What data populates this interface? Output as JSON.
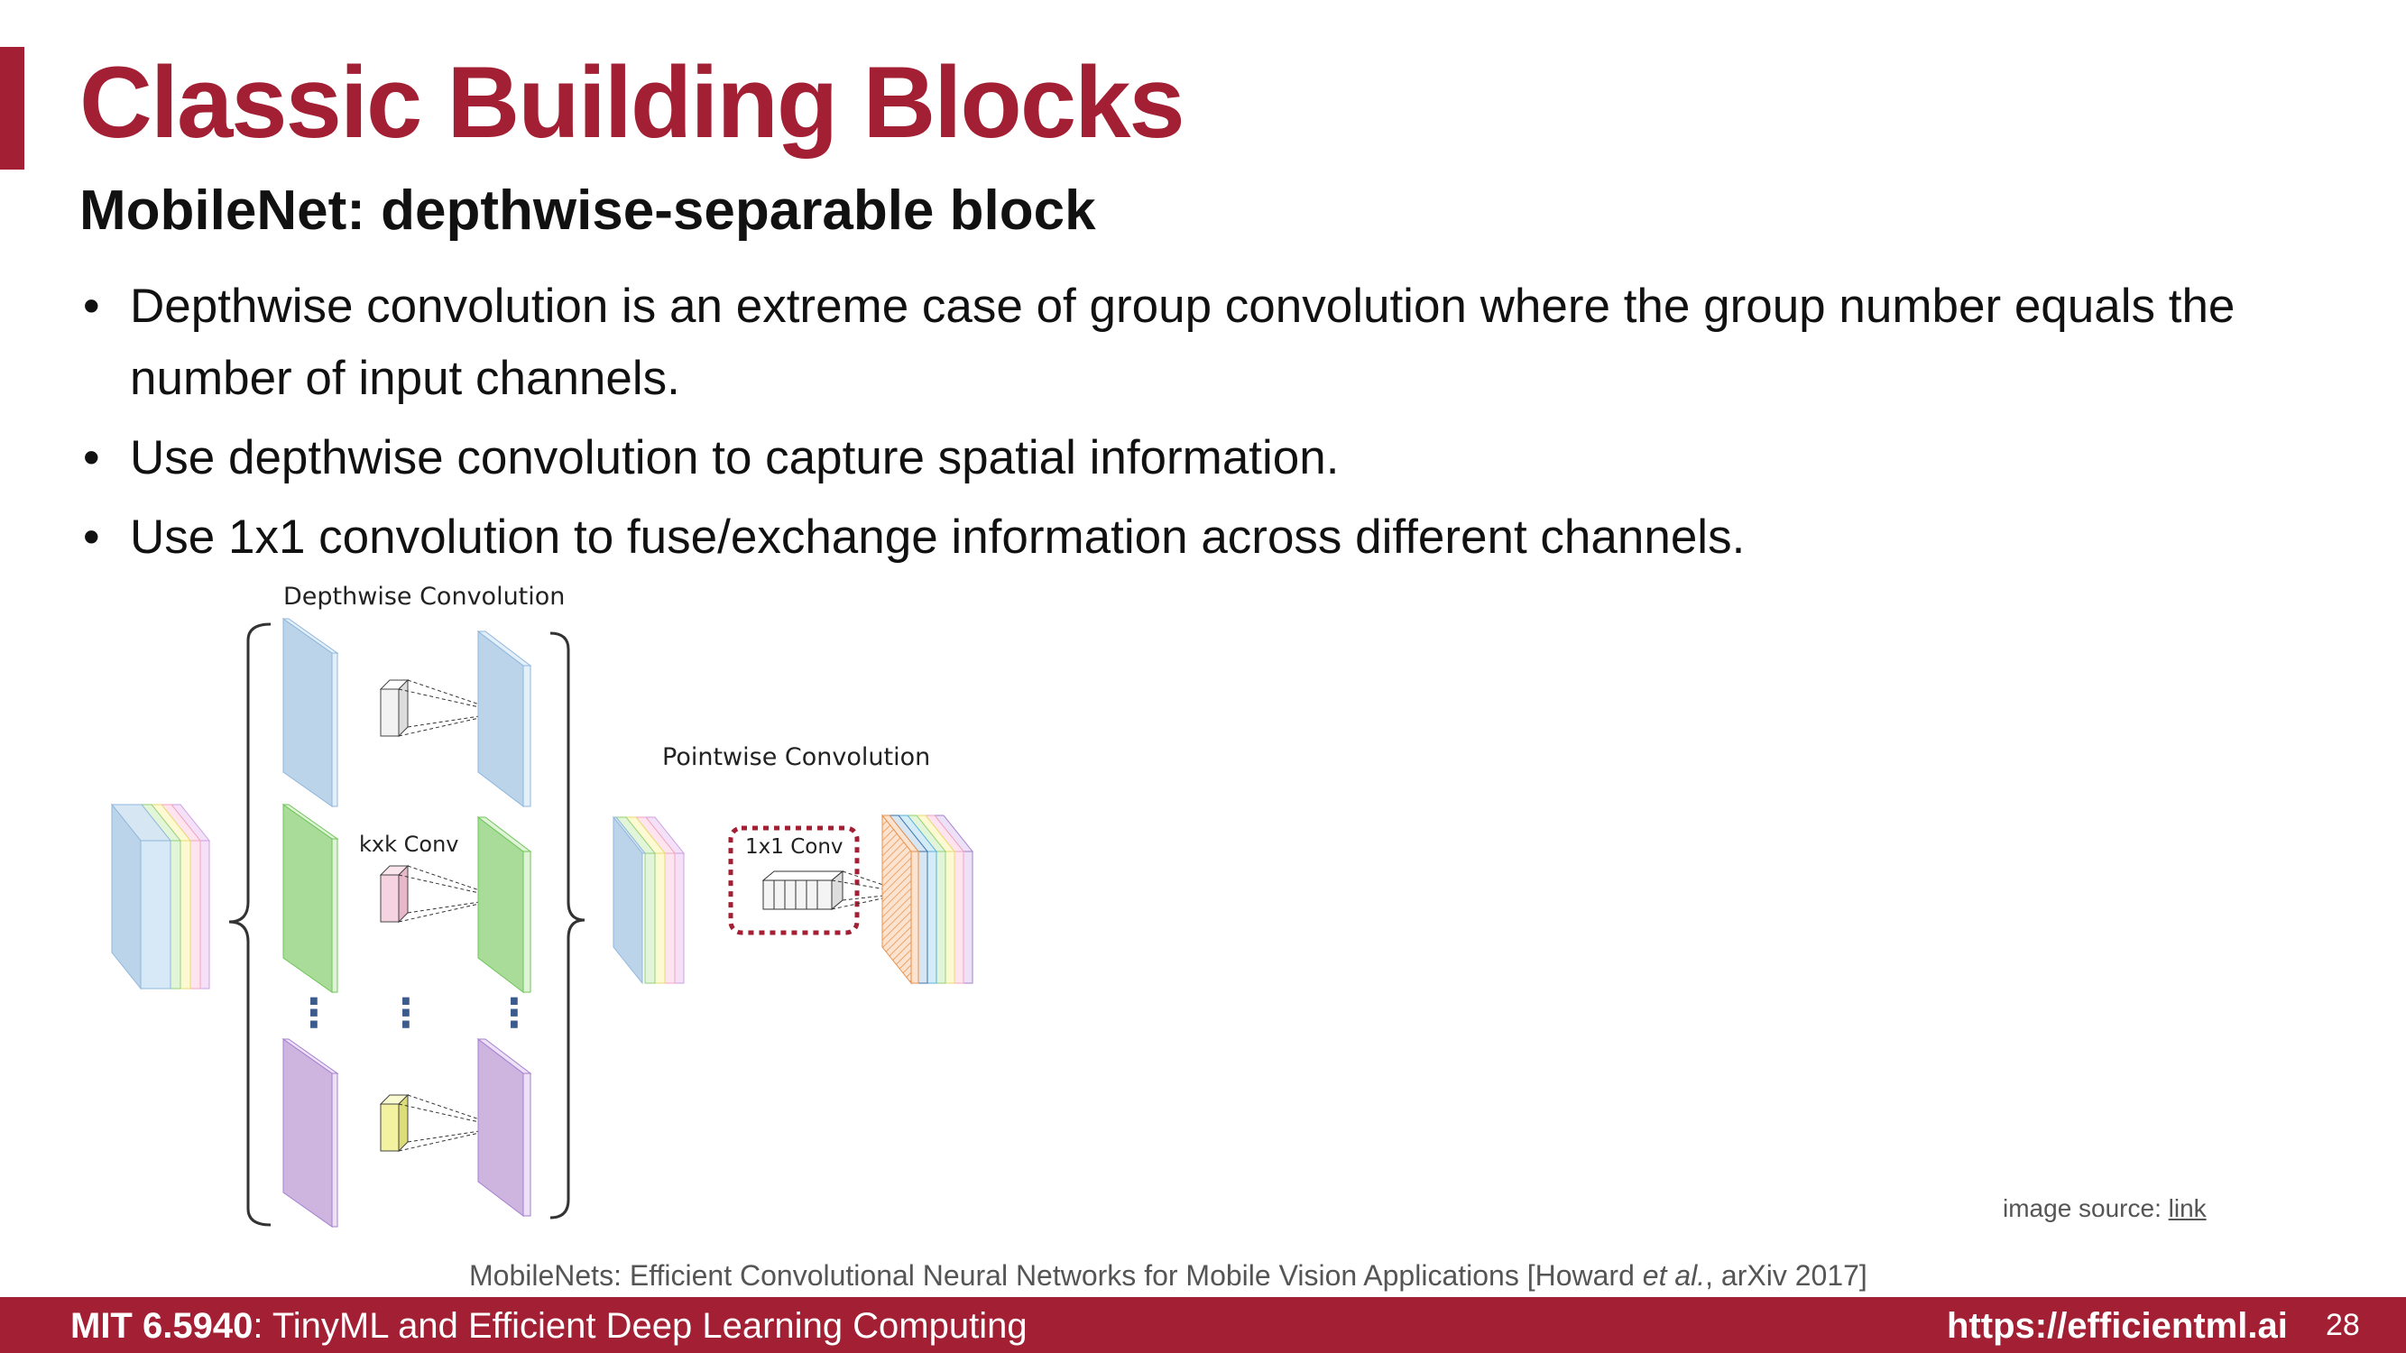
{
  "slide": {
    "title": "Classic Building Blocks",
    "subtitle": "MobileNet: depthwise-separable block",
    "bullets": [
      "Depthwise convolution is an extreme case of group convolution where the group number equals the number of input channels.",
      "Use depthwise convolution to capture spatial information.",
      "Use 1x1 convolution to fuse/exchange information across different channels."
    ],
    "bullet_marker": "•"
  },
  "diagram": {
    "depthwise_label": "Depthwise Convolution",
    "kxk_label": "kxk Conv",
    "pointwise_label": "Pointwise Convolution",
    "conv1x1_label": "1x1 Conv",
    "ellipsis": "⋮",
    "colors": {
      "blue": "#bcd4ea",
      "green": "#a8dc98",
      "purple": "#cdb5e0",
      "orange": "#e8904a",
      "dashed_box": "#a31f34"
    }
  },
  "image_source": {
    "prefix": "image source: ",
    "link_text": "link"
  },
  "citation": {
    "before": "MobileNets: Efficient Convolutional Neural Networks for Mobile Vision Applications [Howard ",
    "italic": "et al.",
    "after": ", arXiv 2017]"
  },
  "footer": {
    "course_code": "MIT 6.5940",
    "course_name": ": TinyML and Efficient Deep Learning Computing",
    "url": "https://efficientml.ai",
    "page_number": "28"
  }
}
